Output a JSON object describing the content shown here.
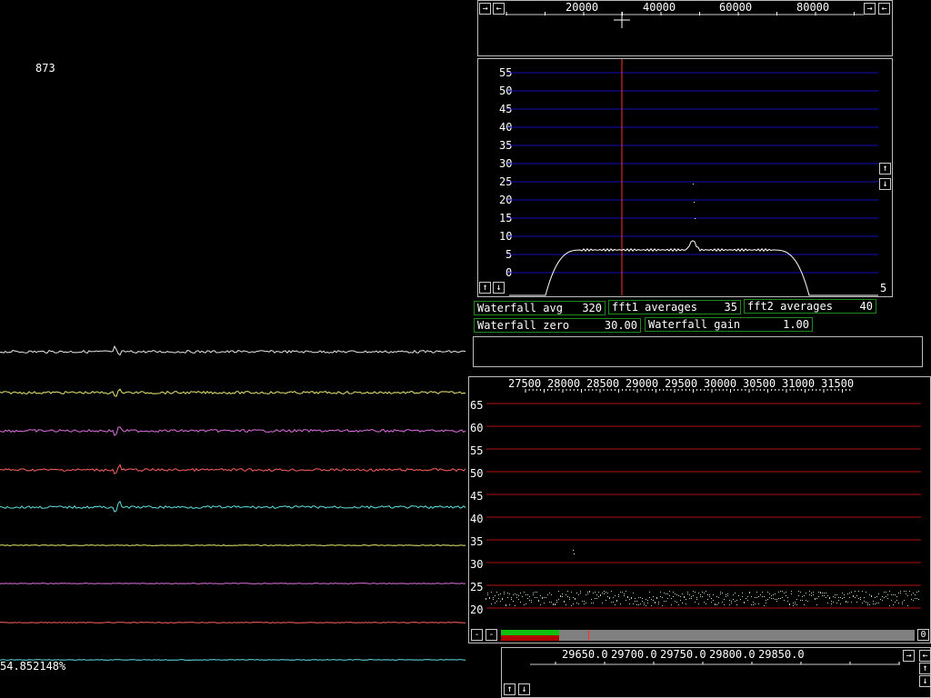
{
  "counter": "873",
  "percent_readout": "54.852148%",
  "top_spectrum": {
    "freq_labels": [
      "20000",
      "40000",
      "60000",
      "80000"
    ],
    "y_labels": [
      "55",
      "50",
      "45",
      "40",
      "35",
      "30",
      "25",
      "20",
      "15",
      "10",
      "5",
      "0"
    ],
    "corner_value": "5",
    "nav_buttons": {
      "right": "→",
      "left": "←",
      "up": "↑",
      "down": "↓"
    }
  },
  "fields": {
    "waterfall_avg": {
      "label": "Waterfall avg",
      "value": "320"
    },
    "fft1_averages": {
      "label": "fft1 averages",
      "value": "35"
    },
    "fft2_averages": {
      "label": "fft2 averages",
      "value": "40"
    },
    "waterfall_zero": {
      "label": "Waterfall zero",
      "value": "30.00"
    },
    "waterfall_gain": {
      "label": "Waterfall gain",
      "value": "1.00"
    }
  },
  "baseband": {
    "freq_labels": [
      "27500",
      "28000",
      "28500",
      "29000",
      "29500",
      "30000",
      "30500",
      "31000",
      "31500"
    ],
    "y_labels": [
      "65",
      "60",
      "55",
      "50",
      "45",
      "40",
      "35",
      "30",
      "25",
      "20"
    ],
    "minus1": "-",
    "minus2": "-",
    "zero_value": "0",
    "signal_level": 0.14
  },
  "hires": {
    "freq_labels": [
      "29650.0",
      "29700.0",
      "29750.0",
      "29800.0",
      "29850.0"
    ],
    "nav_buttons": {
      "right": "→",
      "left": "←",
      "up": "↑",
      "down": "↓"
    }
  },
  "colors": {
    "grid_blue": "#1010c0",
    "grid_red": "#b01010",
    "marker_red": "#ff3030",
    "field_border": "#1e8a1e",
    "trace_colors": [
      "#e8e8e8",
      "#e8e870",
      "#e070e0",
      "#ff6060",
      "#60e0e0",
      "#e8e870",
      "#e070e0",
      "#ff6060",
      "#60e0e0"
    ]
  }
}
